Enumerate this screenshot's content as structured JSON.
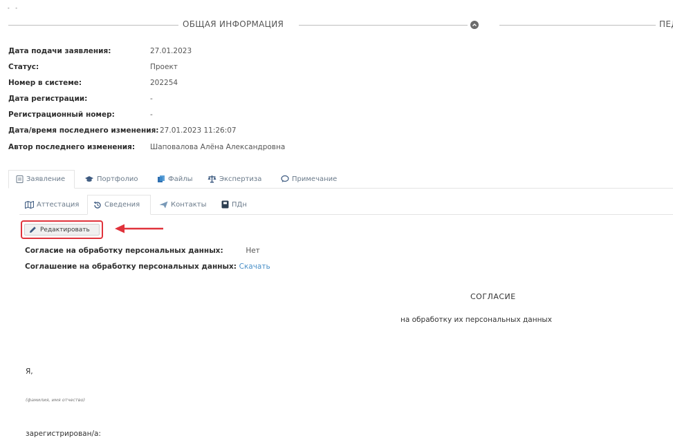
{
  "top_indicator": "• •",
  "section": {
    "title": "ОБЩАЯ ИНФОРМАЦИЯ",
    "right_title": "ПЕД"
  },
  "info": [
    {
      "label": "Дата подачи заявления:",
      "value": "27.01.2023"
    },
    {
      "label": "Статус:",
      "value": "Проект"
    },
    {
      "label": "Номер в системе:",
      "value": "202254"
    },
    {
      "label": "Дата регистрации:",
      "value": "-"
    },
    {
      "label": "Регистрационный номер:",
      "value": "-"
    },
    {
      "label": "Дата/время последнего изменения:",
      "value": "27.01.2023 11:26:07"
    },
    {
      "label": "Автор последнего изменения:",
      "value": "Шаповалова Алёна Александровна"
    }
  ],
  "tabs": [
    {
      "label": "Заявление",
      "icon": "document-icon"
    },
    {
      "label": "Портфолио",
      "icon": "graduation-cap-icon"
    },
    {
      "label": "Файлы",
      "icon": "files-icon"
    },
    {
      "label": "Экспертиза",
      "icon": "scales-icon"
    },
    {
      "label": "Примечание",
      "icon": "comment-icon"
    }
  ],
  "subtabs": [
    {
      "label": "Аттестация",
      "icon": "map-icon"
    },
    {
      "label": "Сведения",
      "icon": "history-icon"
    },
    {
      "label": "Контакты",
      "icon": "send-icon"
    },
    {
      "label": "ПДн",
      "icon": "id-card-icon"
    }
  ],
  "edit_button": {
    "label": "Редактировать",
    "icon": "pencil-icon"
  },
  "consent": {
    "agreement_label": "Согласие на обработку персональных данных:",
    "agreement_value": "Нет",
    "contract_label": "Соглашение на обработку персональных данных:",
    "contract_link": "Скачать"
  },
  "document": {
    "title": "СОГЛАСИЕ",
    "subtitle": "на обработку их персональных данных",
    "ya": "Я,",
    "fio_hint": "(фамилия, имя отчество)",
    "registered": "зарегистрирован/а:"
  },
  "colors": {
    "highlight_red": "#e0323b",
    "link_blue": "#4a90c8",
    "tab_text": "#6a7a8a"
  }
}
